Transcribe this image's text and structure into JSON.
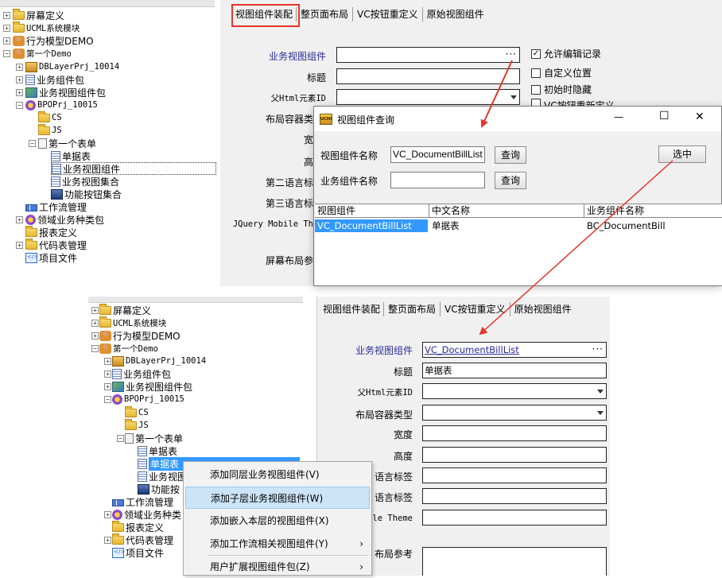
{
  "top_tree": {
    "items": [
      {
        "label": "屏幕定义"
      },
      {
        "label": "UCML系统模块"
      },
      {
        "label": "行为模型DEMO"
      },
      {
        "label": "第一个Demo"
      },
      {
        "label": "DBLayerPrj_10014"
      },
      {
        "label": "业务组件包"
      },
      {
        "label": "业务视图组件包"
      },
      {
        "label": "BPOPrj_10015"
      },
      {
        "label": "CS"
      },
      {
        "label": "JS"
      },
      {
        "label": "第一个表单"
      },
      {
        "label": "单据表"
      },
      {
        "label": "业务视图组件"
      },
      {
        "label": "业务视图集合"
      },
      {
        "label": "功能按钮集合"
      },
      {
        "label": "工作流管理"
      },
      {
        "label": "领域业务种类包"
      },
      {
        "label": "报表定义"
      },
      {
        "label": "代码表管理"
      },
      {
        "label": "项目文件"
      }
    ]
  },
  "top_tabs": [
    "视图组件装配",
    "整页面布局",
    "VC按钮重定义",
    "原始视图组件"
  ],
  "top_form": {
    "bvc_label": "业务视图组件",
    "title_label": "标题",
    "parent_label": "父Html元素ID",
    "layout_label": "布局容器类",
    "width_label": "宽",
    "height_label": "高",
    "lang2_label": "第二语言标",
    "lang3_label": "第三语言标",
    "jqm_label": "JQuery Mobile Th",
    "screen_label": "屏幕布局参",
    "dots": "···"
  },
  "checkboxes": [
    {
      "label": "允许编辑记录",
      "checked": true,
      "mark": "✓"
    },
    {
      "label": "自定义位置",
      "checked": false,
      "mark": ""
    },
    {
      "label": "初始时隐藏",
      "checked": false,
      "mark": ""
    },
    {
      "label": "VC按钮重新定义",
      "checked": false,
      "mark": ""
    }
  ],
  "dialog": {
    "title": "视图组件查询",
    "icon_text": "UCML",
    "vc_name_label": "视图组件名称",
    "vc_name_value": "VC_DocumentBillList",
    "bc_name_label": "业务组件名称",
    "bc_name_value": "",
    "query_label": "查询",
    "select_label": "选中",
    "minimize": "—",
    "maximize": "☐",
    "close": "✕",
    "columns": [
      "视图组件",
      "中文名称",
      "业务组件名称"
    ],
    "rows": [
      [
        "VC_DocumentBillList",
        "单据表",
        "BC_DocumentBill"
      ]
    ]
  },
  "bottom_tree": {
    "items": [
      {
        "label": "屏幕定义"
      },
      {
        "label": "UCML系统模块"
      },
      {
        "label": "行为模型DEMO"
      },
      {
        "label": "第一个Demo"
      },
      {
        "label": "DBLayerPrj_10014"
      },
      {
        "label": "业务组件包"
      },
      {
        "label": "业务视图组件包"
      },
      {
        "label": "BPOPrj_10015"
      },
      {
        "label": "CS"
      },
      {
        "label": "JS"
      },
      {
        "label": "第一个表单"
      },
      {
        "label": "单据表"
      },
      {
        "label": "单据表"
      },
      {
        "label": "业务视图"
      },
      {
        "label": "功能按"
      },
      {
        "label": "工作流管理"
      },
      {
        "label": "领域业务种类"
      },
      {
        "label": "报表定义"
      },
      {
        "label": "代码表管理"
      },
      {
        "label": "项目文件"
      }
    ]
  },
  "bottom_tabs": [
    "视图组件装配",
    "整页面布局",
    "VC按钮重定义",
    "原始视图组件"
  ],
  "bottom_form": {
    "bvc_label": "业务视图组件",
    "bvc_value": "VC_DocumentBillList",
    "title_label": "标题",
    "title_value": "单据表",
    "parent_label": "父Html元素ID",
    "layout_label": "布局容器类型",
    "width_label": "宽度",
    "height_label": "高度",
    "lang2_label": "语言标签",
    "lang3_label": "语言标签",
    "jqm_label": "ile Theme",
    "screen_label": "布局参考",
    "dots": "···"
  },
  "context_menu": {
    "items": [
      {
        "label": "添加同层业务视图组件(V)",
        "submenu": false
      },
      {
        "label": "添加子层业务视图组件(W)",
        "submenu": false,
        "highlighted": true
      },
      {
        "label": "添加嵌入本层的视图组件(X)",
        "submenu": false
      },
      {
        "label": "添加工作流相关视图组件(Y)",
        "submenu": true
      },
      {
        "label": "用户扩展视图组件包(Z)",
        "submenu": true
      }
    ],
    "submenu_glyph": "›"
  },
  "colors": {
    "highlight_red": "#e8342c",
    "selection_blue": "#3399ff",
    "label_blue": "#2a2a9a"
  }
}
